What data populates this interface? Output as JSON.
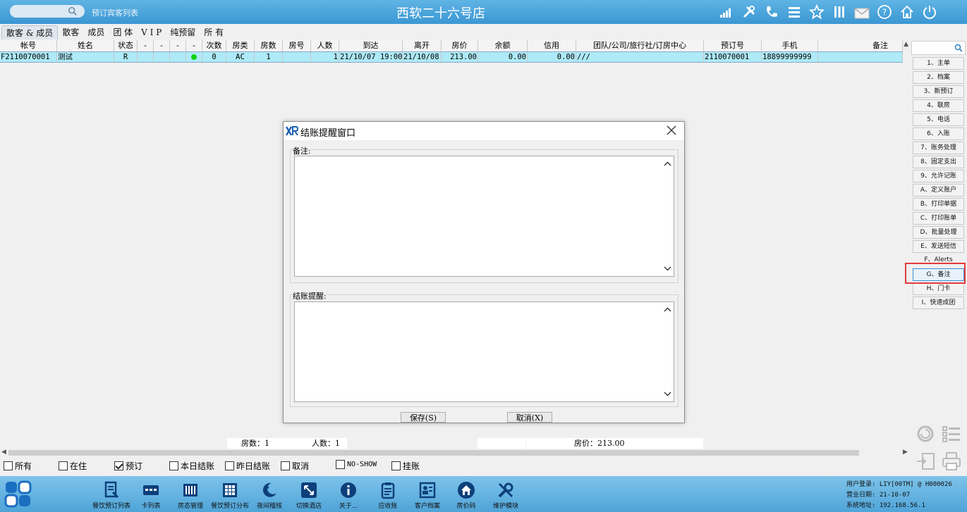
{
  "header": {
    "search_hint": "预订宾客列表",
    "title": "西软二十六号店",
    "icons": [
      "signal-icon",
      "tools-icon",
      "phone-icon",
      "menu-icon",
      "star-icon",
      "columns-icon",
      "mail-icon",
      "help-icon",
      "home-icon",
      "power-icon"
    ]
  },
  "tabs": [
    "散客 & 成员",
    "散客",
    "成员",
    "团 体",
    "V I P",
    "纯预留",
    "所 有"
  ],
  "grid": {
    "columns": [
      "帐号",
      "姓名",
      "状态",
      "-",
      "-",
      "-",
      "-",
      "次数",
      "房类",
      "房数",
      "房号",
      "人数",
      "到达",
      "离开",
      "房价",
      "余额",
      "信用",
      "团队/公司/旅行社/订房中心",
      "预订号",
      "手机",
      "备注"
    ],
    "rows": [
      [
        "F2110070001",
        "测试",
        "R",
        "",
        "",
        "",
        "",
        "0",
        "AC",
        "1",
        "",
        "1",
        "21/10/07 19:00",
        "21/10/08",
        "213.00",
        "0.00",
        "0.00",
        "///",
        "2110070001",
        "18899999999",
        ""
      ]
    ]
  },
  "summary": {
    "rooms": "房数：1",
    "people": "人数：1",
    "price": "房价：213.00"
  },
  "filters": [
    {
      "label": "所有",
      "checked": false
    },
    {
      "label": "在住",
      "checked": false
    },
    {
      "label": "预订",
      "checked": true
    },
    {
      "label": "本日结账",
      "checked": false
    },
    {
      "label": "昨日结账",
      "checked": false
    },
    {
      "label": "取消",
      "checked": false
    },
    {
      "label": "NO-SHOW",
      "checked": false
    },
    {
      "label": "挂账",
      "checked": false
    }
  ],
  "right_menu": [
    "1、主单",
    "2、档案",
    "3、新预订",
    "4、联房",
    "5、电话",
    "6、入账",
    "7、账务处理",
    "8、固定支出",
    "9、允许记账",
    "A、定义账户",
    "B、打印单据",
    "C、打印账单",
    "D、批量处理",
    "E、发送短信",
    "F、Alerts",
    "G、备注",
    "H、门卡",
    "I、快速成团"
  ],
  "dialog": {
    "title": "结账提醒窗口",
    "remark_label": "备注:",
    "remind_label": "结账提醒:",
    "remark_value": "",
    "remind_value": "",
    "save_label": "保存(S)",
    "cancel_label": "取消(X)"
  },
  "taskbar": [
    {
      "label": "餐饮预订列表",
      "icon": "order-list-icon"
    },
    {
      "label": "卡列表",
      "icon": "card-icon"
    },
    {
      "label": "房态管理",
      "icon": "room-status-icon"
    },
    {
      "label": "餐饮预订分布",
      "icon": "distribution-icon"
    },
    {
      "label": "夜间稽核",
      "icon": "moon-icon"
    },
    {
      "label": "切换酒店",
      "icon": "switch-icon"
    },
    {
      "label": "关于...",
      "icon": "info-icon"
    },
    {
      "label": "应收账",
      "icon": "clipboard-icon"
    },
    {
      "label": "客户档案",
      "icon": "profile-icon"
    },
    {
      "label": "房价码",
      "icon": "house-icon"
    },
    {
      "label": "维护模块",
      "icon": "wrench-icon"
    }
  ],
  "status": {
    "user": "用户登录: LIY[00TM] @ H000026",
    "date": "营业日期: 21-10-07",
    "ip": "系统地址: 192.168.56.1"
  },
  "colors": {
    "accent": "#3b97d3",
    "row_selected": "#aeeaf7",
    "highlight": "#e23b3b"
  }
}
